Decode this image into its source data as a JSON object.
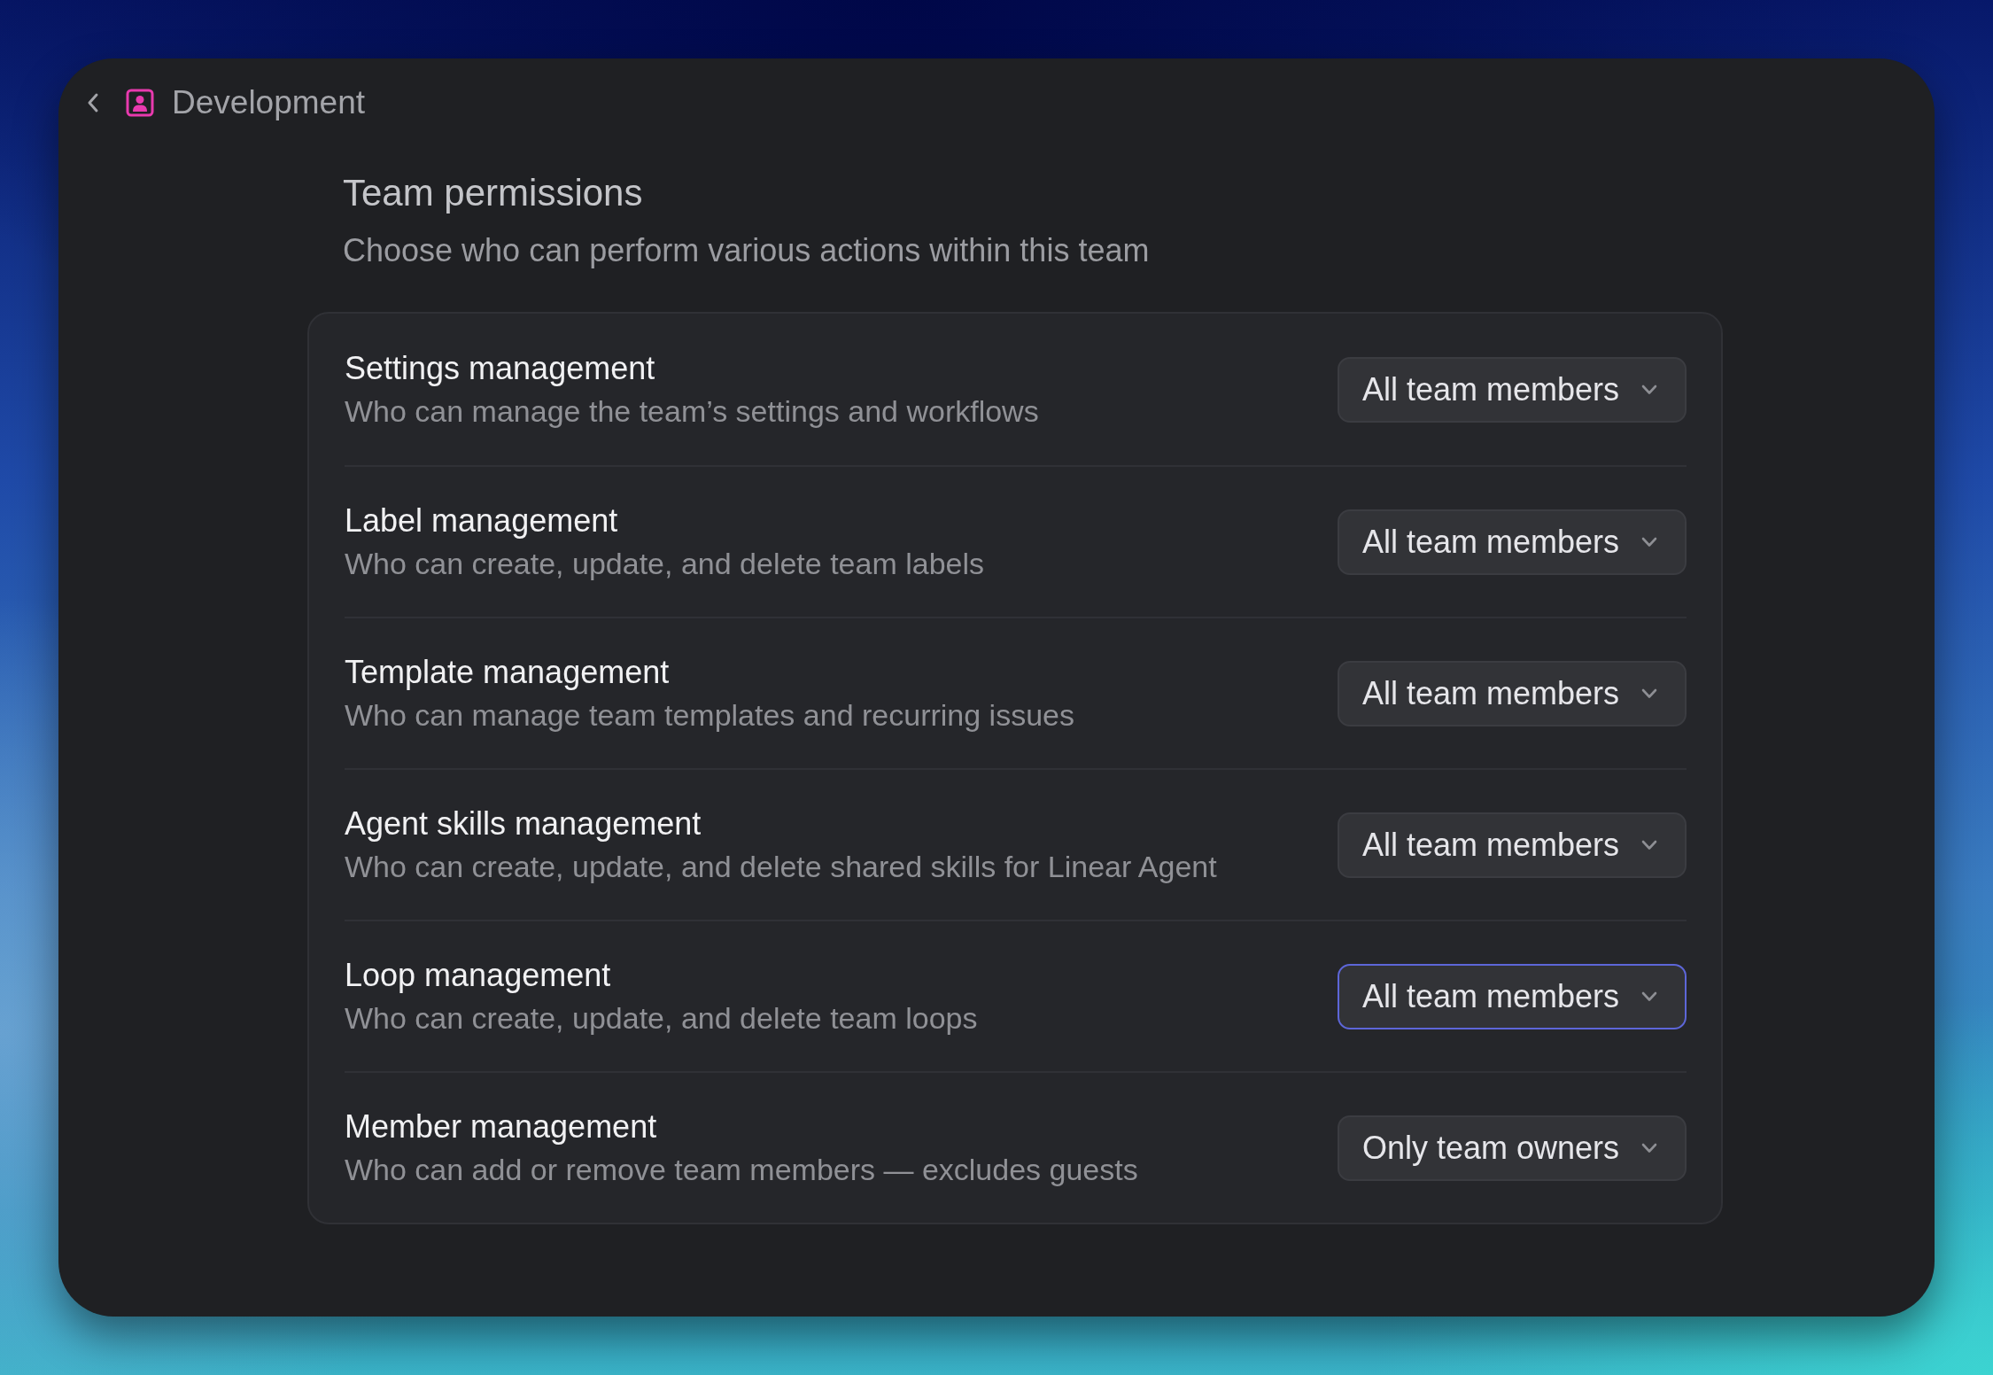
{
  "header": {
    "title": "Development"
  },
  "page": {
    "title": "Team permissions",
    "subtitle": "Choose who can perform various actions within this team"
  },
  "permissions": [
    {
      "title": "Settings management",
      "description": "Who can manage the team’s settings and workflows",
      "value": "All team members",
      "focused": false
    },
    {
      "title": "Label management",
      "description": "Who can create, update, and delete team labels",
      "value": "All team members",
      "focused": false
    },
    {
      "title": "Template management",
      "description": "Who can manage team templates and recurring issues",
      "value": "All team members",
      "focused": false
    },
    {
      "title": "Agent skills management",
      "description": "Who can create, update, and delete shared skills for Linear Agent",
      "value": "All team members",
      "focused": false
    },
    {
      "title": "Loop management",
      "description": "Who can create, update, and delete team loops",
      "value": "All team members",
      "focused": true
    },
    {
      "title": "Member management",
      "description": "Who can add or remove team members — excludes guests",
      "value": "Only team owners",
      "focused": false
    }
  ]
}
